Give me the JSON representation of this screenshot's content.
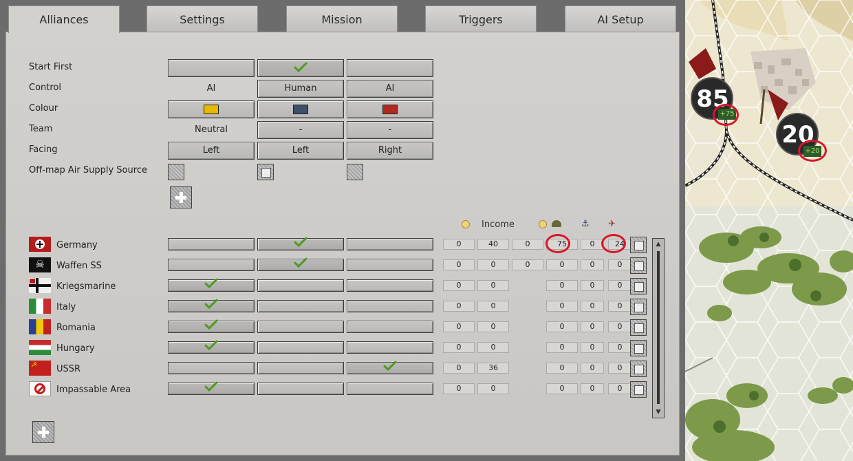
{
  "tabs": [
    "Alliances",
    "Settings",
    "Mission",
    "Triggers",
    "AI Setup"
  ],
  "settings": {
    "rows": [
      {
        "label": "Start First",
        "cells": [
          {
            "type": "button",
            "text": ""
          },
          {
            "type": "button",
            "check": true
          },
          {
            "type": "button",
            "text": ""
          }
        ]
      },
      {
        "label": "Control",
        "cells": [
          {
            "type": "plain",
            "text": "AI"
          },
          {
            "type": "button",
            "text": "Human"
          },
          {
            "type": "button",
            "text": "AI"
          }
        ]
      },
      {
        "label": "Colour",
        "cells": [
          {
            "type": "color",
            "color": "#e6b900"
          },
          {
            "type": "color",
            "color": "#405068"
          },
          {
            "type": "color",
            "color": "#b02a20"
          }
        ]
      },
      {
        "label": "Team",
        "cells": [
          {
            "type": "plain",
            "text": "Neutral"
          },
          {
            "type": "button",
            "text": "-"
          },
          {
            "type": "button",
            "text": "-"
          }
        ]
      },
      {
        "label": "Facing",
        "cells": [
          {
            "type": "button",
            "text": "Left"
          },
          {
            "type": "button",
            "text": "Left"
          },
          {
            "type": "button",
            "text": "Right"
          }
        ]
      },
      {
        "label": "Off-map Air Supply Source",
        "cells": [
          {
            "type": "checkbox",
            "checked": false
          },
          {
            "type": "checkbox",
            "checked": true
          },
          {
            "type": "checkbox",
            "checked": false
          }
        ]
      }
    ]
  },
  "factions": {
    "header": {
      "income": "Income"
    },
    "rows": [
      {
        "name": "Germany",
        "flag": "germany",
        "col": 1,
        "values": [
          "0",
          "40",
          "0",
          "75",
          "0",
          "24"
        ]
      },
      {
        "name": "Waffen SS",
        "flag": "waffen-ss",
        "col": 1,
        "values": [
          "0",
          "0",
          "0",
          "0",
          "0",
          "0"
        ]
      },
      {
        "name": "Kriegsmarine",
        "flag": "kriegsmarine",
        "col": 0,
        "values": [
          "0",
          "0",
          "",
          "0",
          "0",
          "0"
        ]
      },
      {
        "name": "Italy",
        "flag": "italy",
        "col": 0,
        "values": [
          "0",
          "0",
          "",
          "0",
          "0",
          "0"
        ]
      },
      {
        "name": "Romania",
        "flag": "romania",
        "col": 0,
        "values": [
          "0",
          "0",
          "",
          "0",
          "0",
          "0"
        ]
      },
      {
        "name": "Hungary",
        "flag": "hungary",
        "col": 0,
        "values": [
          "0",
          "0",
          "",
          "0",
          "0",
          "0"
        ]
      },
      {
        "name": "USSR",
        "flag": "ussr",
        "col": 2,
        "values": [
          "0",
          "36",
          "",
          "0",
          "0",
          "0"
        ]
      },
      {
        "name": "Impassable Area",
        "flag": "impassable",
        "col": 0,
        "values": [
          "0",
          "0",
          "",
          "0",
          "0",
          "0"
        ]
      }
    ]
  },
  "map": {
    "units": [
      {
        "value": "85",
        "bonus": "+75"
      },
      {
        "value": "20",
        "bonus": "+20"
      }
    ]
  },
  "colors": {
    "check": "#4f9a22",
    "highlight": "#d8162a"
  }
}
